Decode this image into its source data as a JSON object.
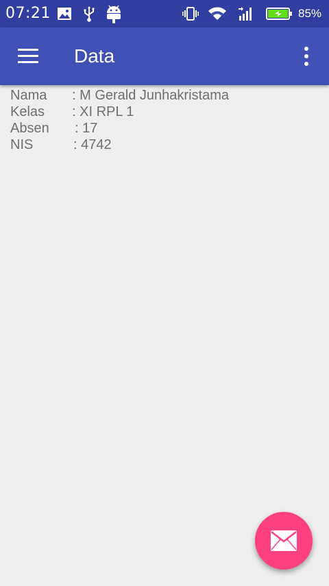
{
  "status_bar": {
    "time": "07:21",
    "battery_percent": "85%",
    "icons": [
      "image-icon",
      "usb-icon",
      "android-icon",
      "vibrate-icon",
      "wifi-icon",
      "signal-icon",
      "battery-charging-icon"
    ]
  },
  "app_bar": {
    "title": "Data",
    "menu_icon": "hamburger-menu-icon",
    "overflow_icon": "more-vert-icon"
  },
  "profile": {
    "rows": [
      {
        "label": "Nama",
        "value": ": M Gerald Junhakristama"
      },
      {
        "label": "Kelas",
        "value": ": XI RPL 1"
      },
      {
        "label": "Absen",
        "value": ": 17"
      },
      {
        "label": "NIS",
        "value": ": 4742"
      }
    ]
  },
  "fab": {
    "icon": "email-icon"
  },
  "colors": {
    "status_bar": "#303f9f",
    "app_bar": "#3f51b5",
    "background": "#eeeeee",
    "text": "#6f6f6f",
    "fab": "#ff4081"
  }
}
